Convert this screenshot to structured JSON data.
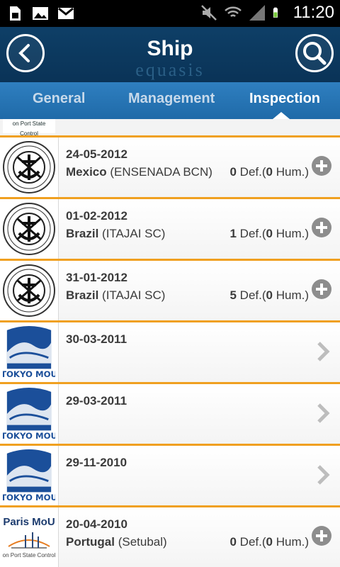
{
  "status_bar": {
    "time": "11:20",
    "icons": [
      "sim-card-icon",
      "image-icon",
      "gmail-icon",
      "mute-icon",
      "wifi-icon",
      "signal-icon",
      "battery-icon"
    ]
  },
  "header": {
    "title": "Ship",
    "brand": "equasis",
    "back_icon": "back-arrow-icon",
    "search_icon": "search-icon"
  },
  "tabs": [
    {
      "label": "General",
      "active": false
    },
    {
      "label": "Management",
      "active": false
    },
    {
      "label": "Inspection",
      "active": true
    }
  ],
  "partial_row": {
    "logo_text": "on Port State Control"
  },
  "inspections": [
    {
      "date": "24-05-2012",
      "country": "Mexico",
      "place": "(ENSENADA BCN)",
      "deficiencies": "0",
      "def_label": "Def.(",
      "human": "0",
      "hum_label": "Hum.)",
      "logo": "vina-del-mar-logo",
      "action": "plus-icon"
    },
    {
      "date": "01-02-2012",
      "country": "Brazil",
      "place": "(ITAJAI SC)",
      "deficiencies": "1",
      "def_label": "Def.(",
      "human": "0",
      "hum_label": "Hum.)",
      "logo": "vina-del-mar-logo",
      "action": "plus-icon"
    },
    {
      "date": "31-01-2012",
      "country": "Brazil",
      "place": "(ITAJAI SC)",
      "deficiencies": "5",
      "def_label": "Def.(",
      "human": "0",
      "hum_label": "Hum.)",
      "logo": "vina-del-mar-logo",
      "action": "plus-icon"
    },
    {
      "date": "30-03-2011",
      "logo": "tokyo-mou-logo",
      "logo_text": "TOKYO MOU",
      "action": "chevron-right-icon"
    },
    {
      "date": "29-03-2011",
      "logo": "tokyo-mou-logo",
      "logo_text": "TOKYO MOU",
      "action": "chevron-right-icon"
    },
    {
      "date": "29-11-2010",
      "logo": "tokyo-mou-logo",
      "logo_text": "TOKYO MOU",
      "action": "chevron-right-icon"
    },
    {
      "date": "20-04-2010",
      "country": "Portugal",
      "place": "(Setubal)",
      "deficiencies": "0",
      "def_label": "Def.(",
      "human": "0",
      "hum_label": "Hum.)",
      "logo": "paris-mou-logo",
      "logo_title": "Paris MoU",
      "logo_sub": "on Port State Control",
      "action": "plus-icon"
    }
  ],
  "colors": {
    "header_bg": "#0e3f67",
    "tab_bg": "#2f7fc0",
    "row_divider": "#f0a020",
    "icon_grey": "#8d8d8d"
  }
}
